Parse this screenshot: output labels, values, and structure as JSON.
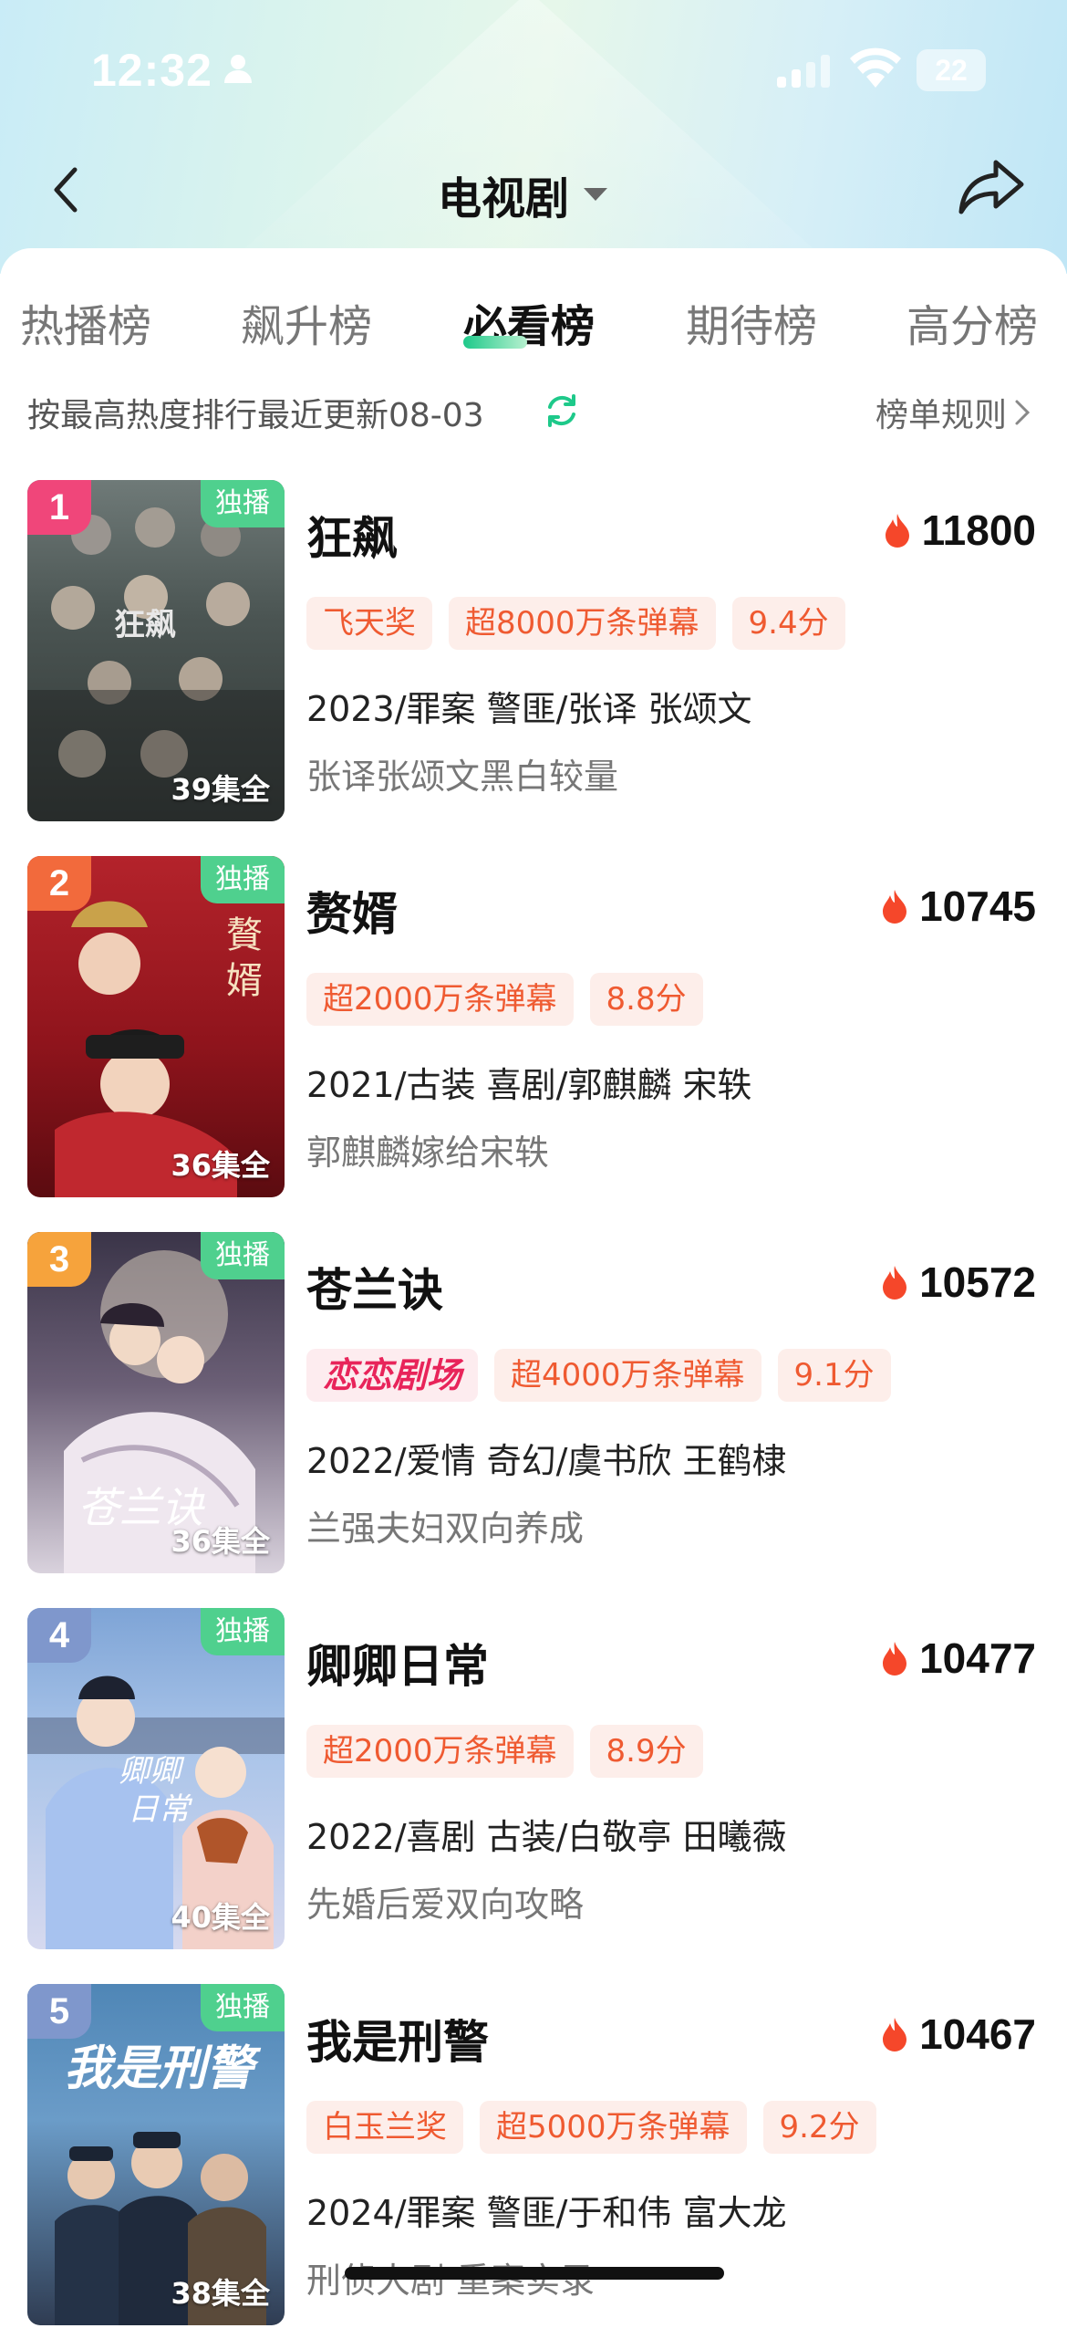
{
  "status_bar": {
    "time": "12:32",
    "battery": "22"
  },
  "nav": {
    "title": "电视剧"
  },
  "tabs": [
    "热播榜",
    "飙升榜",
    "必看榜",
    "期待榜",
    "高分榜"
  ],
  "active_tab": "必看榜",
  "subheader": {
    "text": "按最高热度排行最近更新08-03",
    "rules_label": "榜单规则"
  },
  "colors": {
    "accent_green": "#1ec98a",
    "tag_text": "#ef5a31",
    "tag_bg": "#fdeeea",
    "heat": "#f5472a"
  },
  "items": [
    {
      "rank": "1",
      "exclusive": "独播",
      "episodes": "39集全",
      "title": "狂飙",
      "heat": "11800",
      "tags": [
        "飞天奖",
        "超8000万条弹幕",
        "9.4分"
      ],
      "meta": "2023/罪案 警匪/张译 张颂文",
      "desc": "张译张颂文黑白较量",
      "rank_color": "#f0467a"
    },
    {
      "rank": "2",
      "exclusive": "独播",
      "episodes": "36集全",
      "title": "赘婿",
      "heat": "10745",
      "tags": [
        "超2000万条弹幕",
        "8.8分"
      ],
      "meta": "2021/古装 喜剧/郭麒麟 宋轶",
      "desc": "郭麒麟嫁给宋轶",
      "rank_color": "#f26a3c"
    },
    {
      "rank": "3",
      "exclusive": "独播",
      "episodes": "36集全",
      "title": "苍兰诀",
      "heat": "10572",
      "logo_tag": "恋恋剧场",
      "tags": [
        "超4000万条弹幕",
        "9.1分"
      ],
      "meta": "2022/爱情 奇幻/虞书欣 王鹤棣",
      "desc": "兰强夫妇双向养成",
      "rank_color": "#f6a33c"
    },
    {
      "rank": "4",
      "exclusive": "独播",
      "episodes": "40集全",
      "title": "卿卿日常",
      "heat": "10477",
      "tags": [
        "超2000万条弹幕",
        "8.9分"
      ],
      "meta": "2022/喜剧 古装/白敬亭 田曦薇",
      "desc": "先婚后爱双向攻略",
      "rank_color": "#7f97cc"
    },
    {
      "rank": "5",
      "exclusive": "独播",
      "episodes": "38集全",
      "title": "我是刑警",
      "heat": "10467",
      "tags": [
        "白玉兰奖",
        "超5000万条弹幕",
        "9.2分"
      ],
      "meta": "2024/罪案 警匪/于和伟 富大龙",
      "desc": "刑侦大剧 重案实录",
      "rank_color": "#7f97cc"
    }
  ]
}
